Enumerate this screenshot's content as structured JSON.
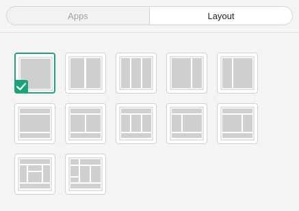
{
  "tabs": [
    {
      "label": "Apps",
      "active": false
    },
    {
      "label": "Layout",
      "active": true
    }
  ],
  "accent_color": "#1aa37a",
  "layouts": [
    {
      "name": "single",
      "selected": true
    },
    {
      "name": "two-columns",
      "selected": false
    },
    {
      "name": "three-columns",
      "selected": false
    },
    {
      "name": "wide-left-narrow-right",
      "selected": false
    },
    {
      "name": "narrow-left-wide-right",
      "selected": false
    },
    {
      "name": "header-body-footer",
      "selected": false
    },
    {
      "name": "header-two-columns-footer",
      "selected": false
    },
    {
      "name": "header-three-columns-footer",
      "selected": false
    },
    {
      "name": "header-narrow-wide-footer",
      "selected": false
    },
    {
      "name": "header-wide-narrow-footer",
      "selected": false
    },
    {
      "name": "header-side-stacked-footer",
      "selected": false
    },
    {
      "name": "header-stacked-grid-footer",
      "selected": false
    }
  ]
}
